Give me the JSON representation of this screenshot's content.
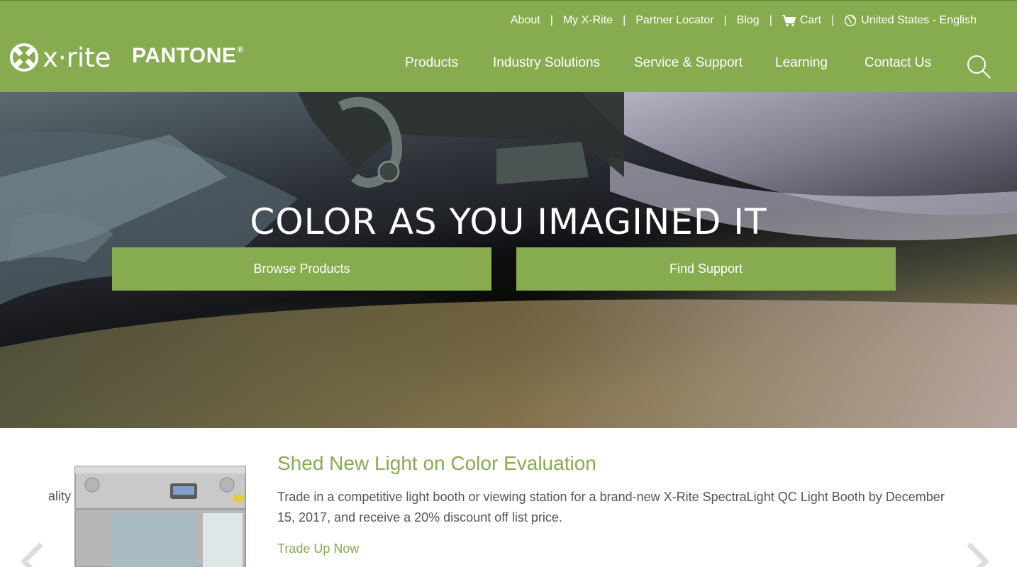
{
  "brand": {
    "xrite": "x·rite",
    "pantone": "PANTONE",
    "pantone_mark": "®"
  },
  "utility_nav": {
    "about": "About",
    "my_xrite": "My X-Rite",
    "partner_locator": "Partner Locator",
    "blog": "Blog",
    "cart": "Cart",
    "region": "United States - English",
    "separator": "|"
  },
  "main_nav": {
    "products": "Products",
    "industry_solutions": "Industry Solutions",
    "service_support": "Service & Support",
    "learning": "Learning",
    "contact_us": "Contact Us"
  },
  "hero": {
    "title": "COLOR AS YOU IMAGINED IT",
    "browse_button": "Browse Products",
    "support_button": "Find Support"
  },
  "promo": {
    "cut_text": "ality",
    "title": "Shed New Light on Color Evaluation",
    "line1": "Trade in a competitive light booth or viewing station for a brand-new X-Rite SpectraLight QC Light Booth by December",
    "line2": "15, 2017, and receive a 20% discount off list price.",
    "link": "Trade Up Now"
  },
  "colors": {
    "brand_green": "#86ac4f",
    "text_gray": "#555555"
  },
  "icons": [
    "xrite-logo-icon",
    "cart-icon",
    "globe-icon",
    "search-icon",
    "chevron-left-icon",
    "chevron-right-icon"
  ]
}
